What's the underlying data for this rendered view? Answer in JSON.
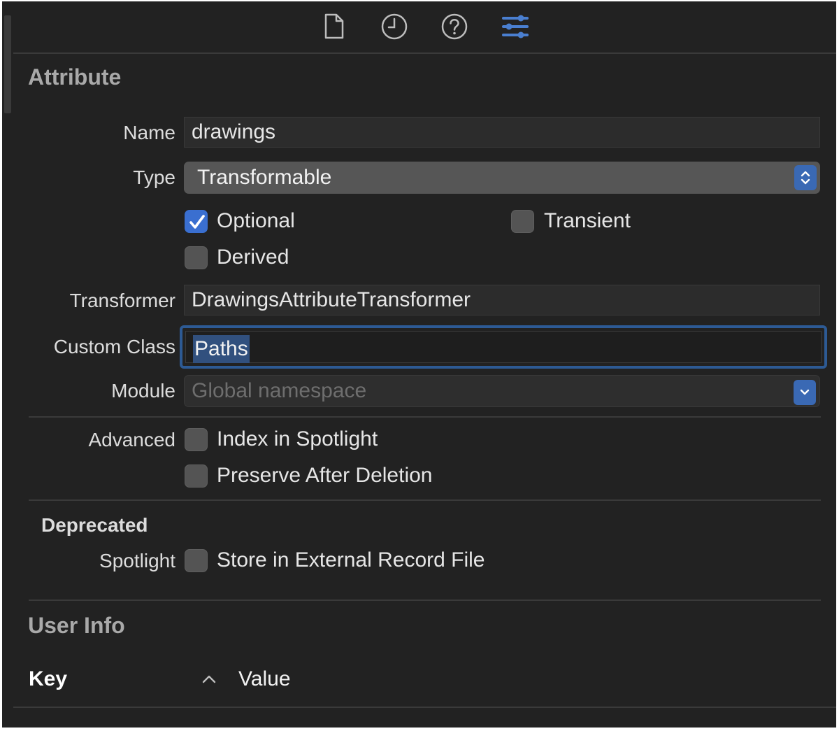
{
  "toolbar": {
    "icons": [
      {
        "name": "file-inspector-icon",
        "active": false
      },
      {
        "name": "history-inspector-icon",
        "active": false
      },
      {
        "name": "help-inspector-icon",
        "active": false
      },
      {
        "name": "attributes-inspector-icon",
        "active": true
      }
    ],
    "accent": "#4a7fd0"
  },
  "attribute": {
    "title": "Attribute",
    "name_label": "Name",
    "name_value": "drawings",
    "type_label": "Type",
    "type_value": "Transformable",
    "optional_label": "Optional",
    "optional_checked": true,
    "transient_label": "Transient",
    "transient_checked": false,
    "derived_label": "Derived",
    "derived_checked": false,
    "transformer_label": "Transformer",
    "transformer_value": "DrawingsAttributeTransformer",
    "custom_class_label": "Custom Class",
    "custom_class_value": "Paths",
    "module_label": "Module",
    "module_placeholder": "Global namespace",
    "advanced_label": "Advanced",
    "index_spotlight_label": "Index in Spotlight",
    "index_spotlight_checked": false,
    "preserve_label": "Preserve After Deletion",
    "preserve_checked": false,
    "deprecated_label": "Deprecated",
    "spotlight_label": "Spotlight",
    "external_record_label": "Store in External Record File",
    "external_record_checked": false
  },
  "user_info": {
    "title": "User Info",
    "key_header": "Key",
    "value_header": "Value",
    "sort_icon": "chevron-up-icon"
  }
}
